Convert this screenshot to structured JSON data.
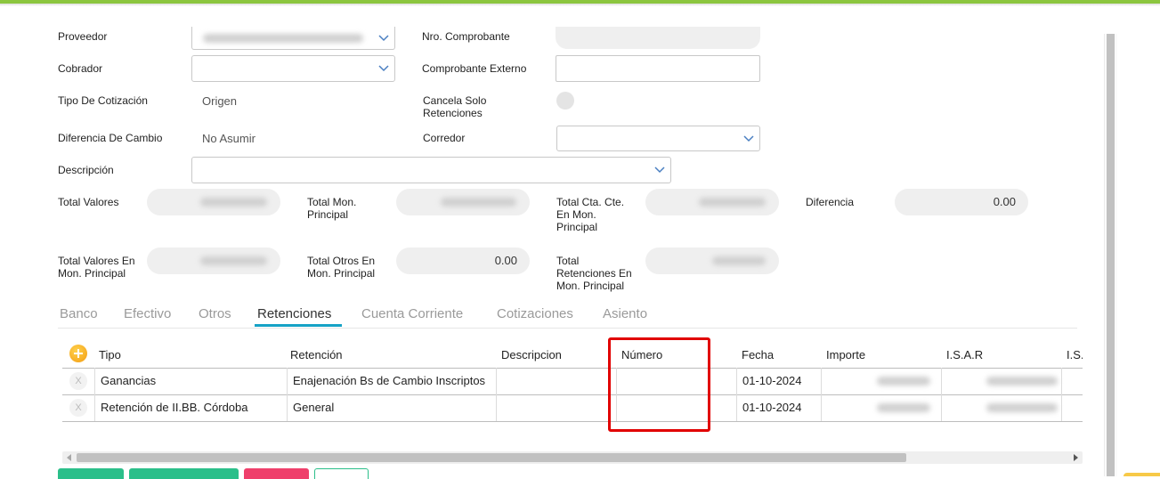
{
  "form": {
    "proveedor_label": "Proveedor",
    "nro_comprobante_label": "Nro. Comprobante",
    "cobrador_label": "Cobrador",
    "comprobante_externo_label": "Comprobante Externo",
    "tipo_cotizacion_label": "Tipo De Cotización",
    "tipo_cotizacion_value": "Origen",
    "cancela_solo_retenciones_label_1": "Cancela Solo",
    "cancela_solo_retenciones_label_2": "Retenciones",
    "diferencia_cambio_label": "Diferencia De Cambio",
    "diferencia_cambio_value": "No Asumir",
    "corredor_label": "Corredor",
    "descripcion_label": "Descripción"
  },
  "totals": {
    "total_valores_label": "Total Valores",
    "total_mon_principal_label_1": "Total Mon.",
    "total_mon_principal_label_2": "Principal",
    "total_cta_cte_label_1": "Total Cta. Cte.",
    "total_cta_cte_label_2": "En Mon.",
    "total_cta_cte_label_3": "Principal",
    "diferencia_label": "Diferencia",
    "diferencia_value": "0.00",
    "total_valores_mon_label_1": "Total Valores En",
    "total_valores_mon_label_2": "Mon. Principal",
    "total_otros_label_1": "Total Otros En",
    "total_otros_label_2": "Mon. Principal",
    "total_otros_value": "0.00",
    "total_retenciones_label_1": "Total",
    "total_retenciones_label_2": "Retenciones En",
    "total_retenciones_label_3": "Mon. Principal"
  },
  "tabs": [
    {
      "label": "Banco"
    },
    {
      "label": "Efectivo"
    },
    {
      "label": "Otros"
    },
    {
      "label": "Retenciones"
    },
    {
      "label": "Cuenta Corriente"
    },
    {
      "label": "Cotizaciones"
    },
    {
      "label": "Asiento"
    }
  ],
  "active_tab": "Retenciones",
  "table": {
    "headers": [
      "Tipo",
      "Retención",
      "Descripcion",
      "Número",
      "Fecha",
      "Importe",
      "I.S.A.R",
      "I.S."
    ],
    "rows": [
      {
        "delete": "X",
        "tipo": "Ganancias",
        "retencion": "Enajenación Bs de Cambio Inscriptos",
        "descripcion": "",
        "numero": "",
        "fecha": "01-10-2024"
      },
      {
        "delete": "X",
        "tipo": "Retención de II.BB. Córdoba",
        "retencion": "General",
        "descripcion": "",
        "numero": "",
        "fecha": "01-10-2024"
      }
    ]
  },
  "colors": {
    "accent_top": "#8cc63f",
    "tab_indicator": "#16a2c6",
    "highlight": "#e10000",
    "add_icon": "#f39c12",
    "btn_green": "#2bbf8a",
    "btn_pink": "#ef3f6b"
  }
}
